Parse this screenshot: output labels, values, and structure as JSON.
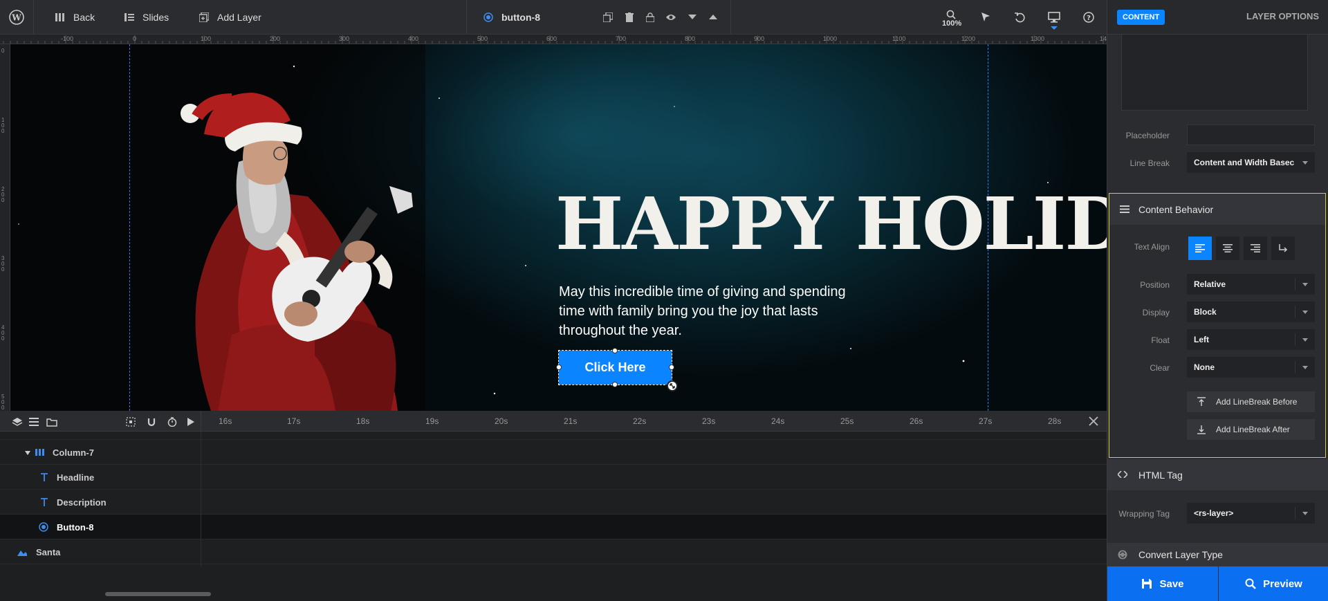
{
  "toolbar": {
    "back_label": "Back",
    "slides_label": "Slides",
    "add_layer_label": "Add Layer",
    "selected_layer": "button-8",
    "zoom": "100%"
  },
  "rulers": {
    "top": [
      "-100",
      "0",
      "100",
      "200",
      "300",
      "400",
      "500",
      "600",
      "700",
      "800",
      "900",
      "1000",
      "1100",
      "1200",
      "1300",
      "14"
    ],
    "left": [
      "0",
      "100",
      "200",
      "300",
      "400",
      "500"
    ]
  },
  "canvas": {
    "headline": "HAPPY HOLIDA",
    "description": "May this incredible time of giving and spending time with family bring you the joy that lasts throughout the year.",
    "button_label": "Click Here"
  },
  "timeline": {
    "times": [
      "16s",
      "17s",
      "18s",
      "19s",
      "20s",
      "21s",
      "22s",
      "23s",
      "24s",
      "25s",
      "26s",
      "27s",
      "28s"
    ]
  },
  "layers": [
    {
      "name": "Column-7",
      "icon": "column-icon"
    },
    {
      "name": "Headline",
      "icon": "text-icon"
    },
    {
      "name": "Description",
      "icon": "text-icon"
    },
    {
      "name": "Button-8",
      "icon": "button-layer-icon"
    },
    {
      "name": "Santa",
      "icon": "image-icon"
    }
  ],
  "panel": {
    "tab_content": "CONTENT",
    "tab_layer_options": "LAYER OPTIONS",
    "placeholder_label": "Placeholder",
    "placeholder_value": "",
    "line_break_label": "Line Break",
    "line_break_value": "Content and Width Basec",
    "content_behavior_title": "Content Behavior",
    "text_align_label": "Text Align",
    "position_label": "Position",
    "position_value": "Relative",
    "display_label": "Display",
    "display_value": "Block",
    "float_label": "Float",
    "float_value": "Left",
    "clear_label": "Clear",
    "clear_value": "None",
    "add_linebreak_before": "Add LineBreak Before",
    "add_linebreak_after": "Add LineBreak After",
    "html_tag_title": "HTML Tag",
    "wrapping_tag_label": "Wrapping Tag",
    "wrapping_tag_value": "<rs-layer>",
    "convert_layer_title": "Convert Layer Type",
    "save_label": "Save",
    "preview_label": "Preview"
  },
  "colors": {
    "accent": "#0a84ff",
    "highlight_border": "#d8c93f",
    "guide": "#2a7cf0"
  }
}
